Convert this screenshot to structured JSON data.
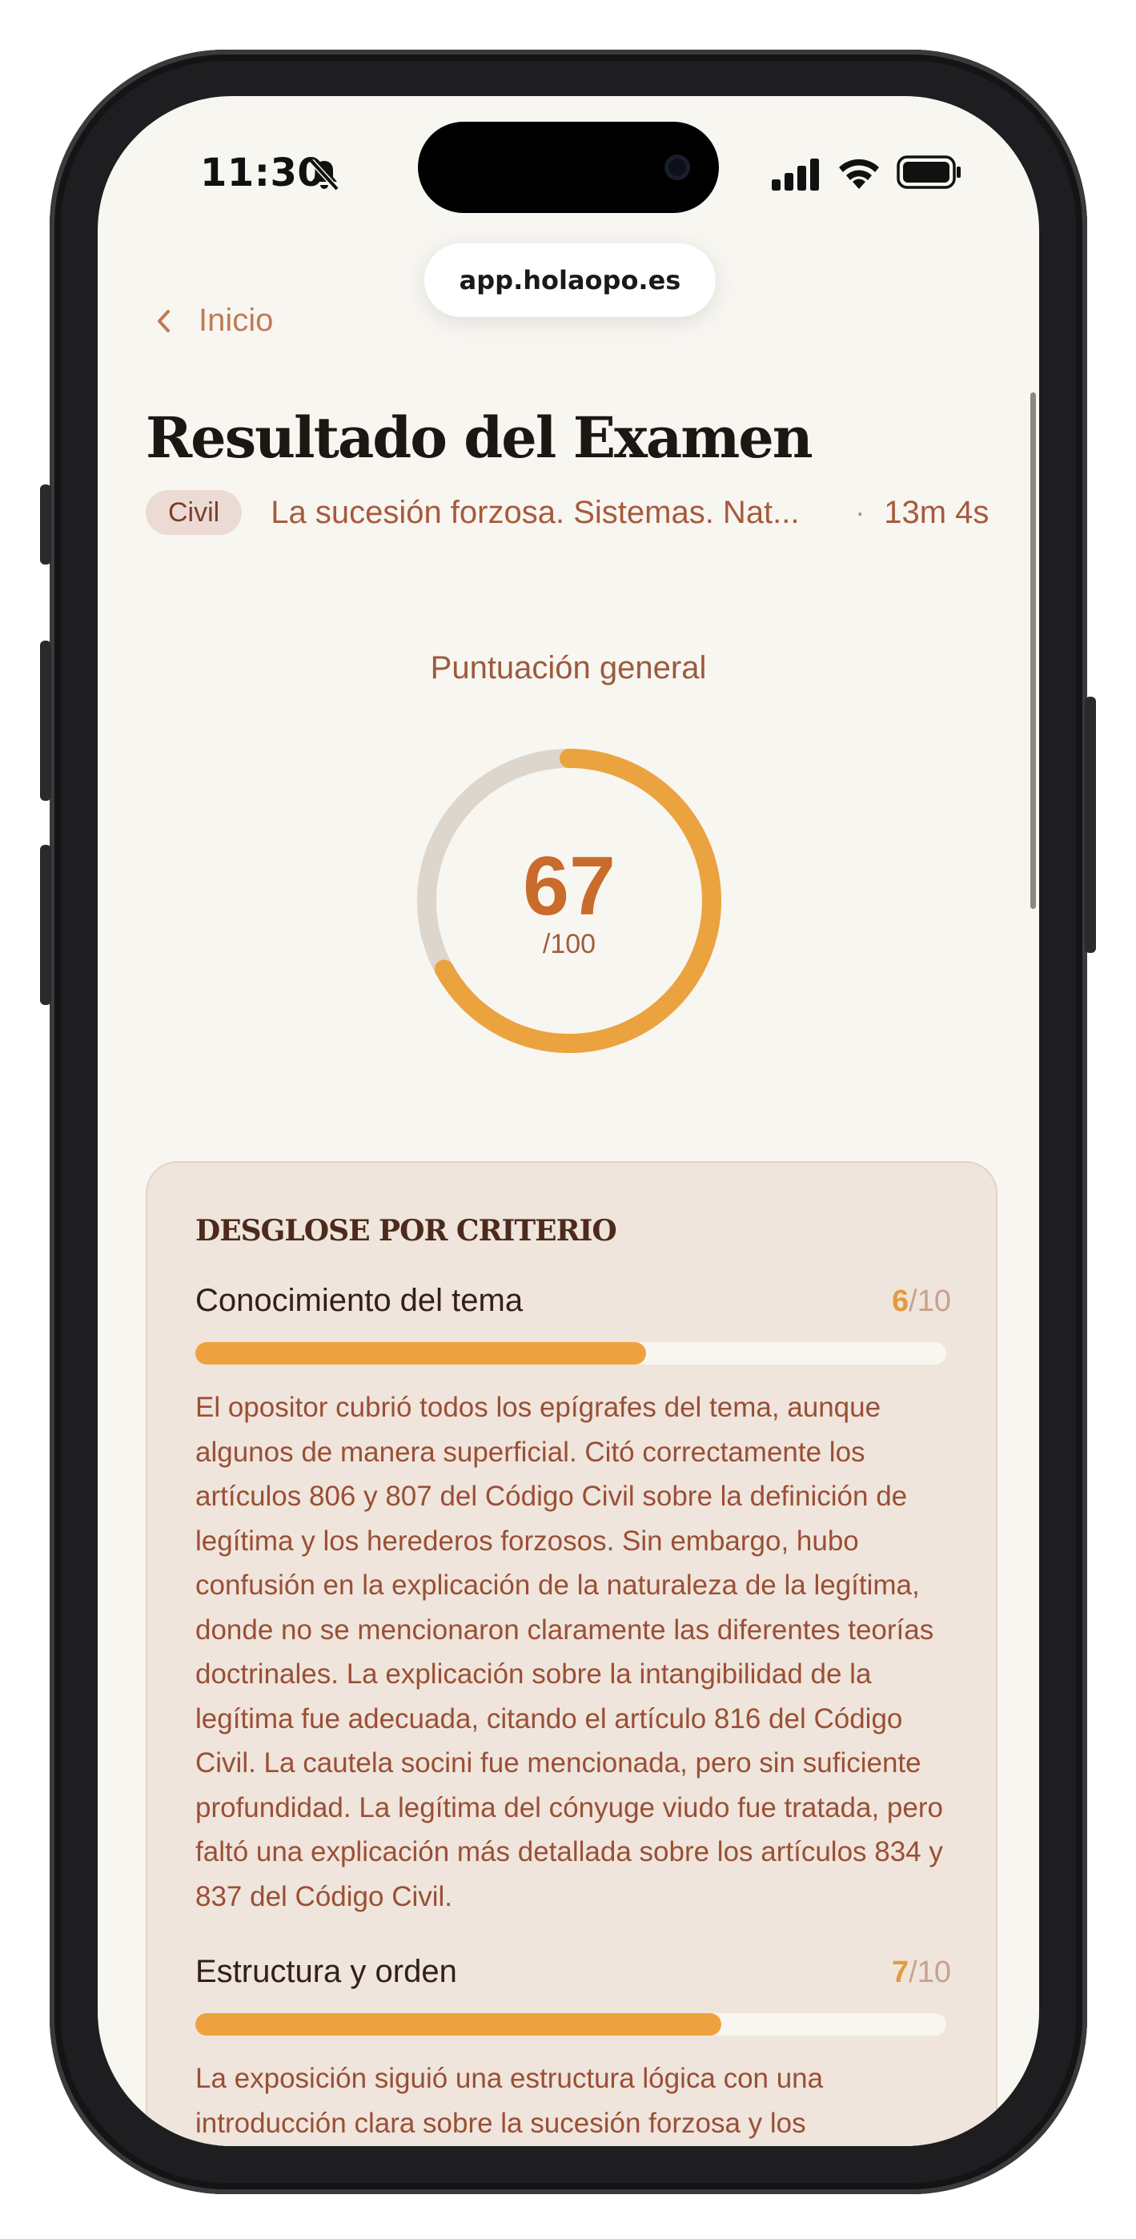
{
  "status_bar": {
    "time": "11:30"
  },
  "browser": {
    "url": "app.holaopo.es"
  },
  "nav": {
    "back_label": "Inicio"
  },
  "page": {
    "title": "Resultado del Examen",
    "tag": "Civil",
    "topic": "La sucesión forzosa. Sistemas. Nat...",
    "separator": "·",
    "duration": "13m 4s"
  },
  "score": {
    "label": "Puntuación general",
    "value": "67",
    "max_label": "/100",
    "fraction": 0.67,
    "colors": {
      "progress": "#eba33f",
      "track": "#ddd6cc",
      "value": "#c96b2b"
    }
  },
  "breakdown": {
    "title": "DESGLOSE POR CRITERIO",
    "criteria": [
      {
        "name": "Conocimiento del tema",
        "score": "6",
        "max": "/10",
        "fraction": 0.6,
        "feedback": "El opositor cubrió todos los epígrafes del tema, aunque algunos de manera superficial. Citó correctamente los artículos 806 y 807 del Código Civil sobre la definición de legítima y los herederos forzosos. Sin embargo, hubo confusión en la explicación de la naturaleza de la legítima, donde no se mencionaron claramente las diferentes teorías doctrinales. La explicación sobre la intangibilidad de la legítima fue adecuada, citando el artículo 816 del Código Civil. La cautela socini fue mencionada, pero sin suficiente profundidad. La legítima del cónyuge viudo fue tratada, pero faltó una explicación más detallada sobre los artículos 834 y 837 del Código Civil."
      },
      {
        "name": "Estructura y orden",
        "score": "7",
        "max": "/10",
        "fraction": 0.7,
        "feedback": "La exposición siguió una estructura lógica con una introducción clara sobre la sucesión forzosa y los"
      }
    ]
  },
  "theme": {
    "accent": "#eea23f",
    "background": "#f8f6f1",
    "card": "#efe5dc"
  }
}
